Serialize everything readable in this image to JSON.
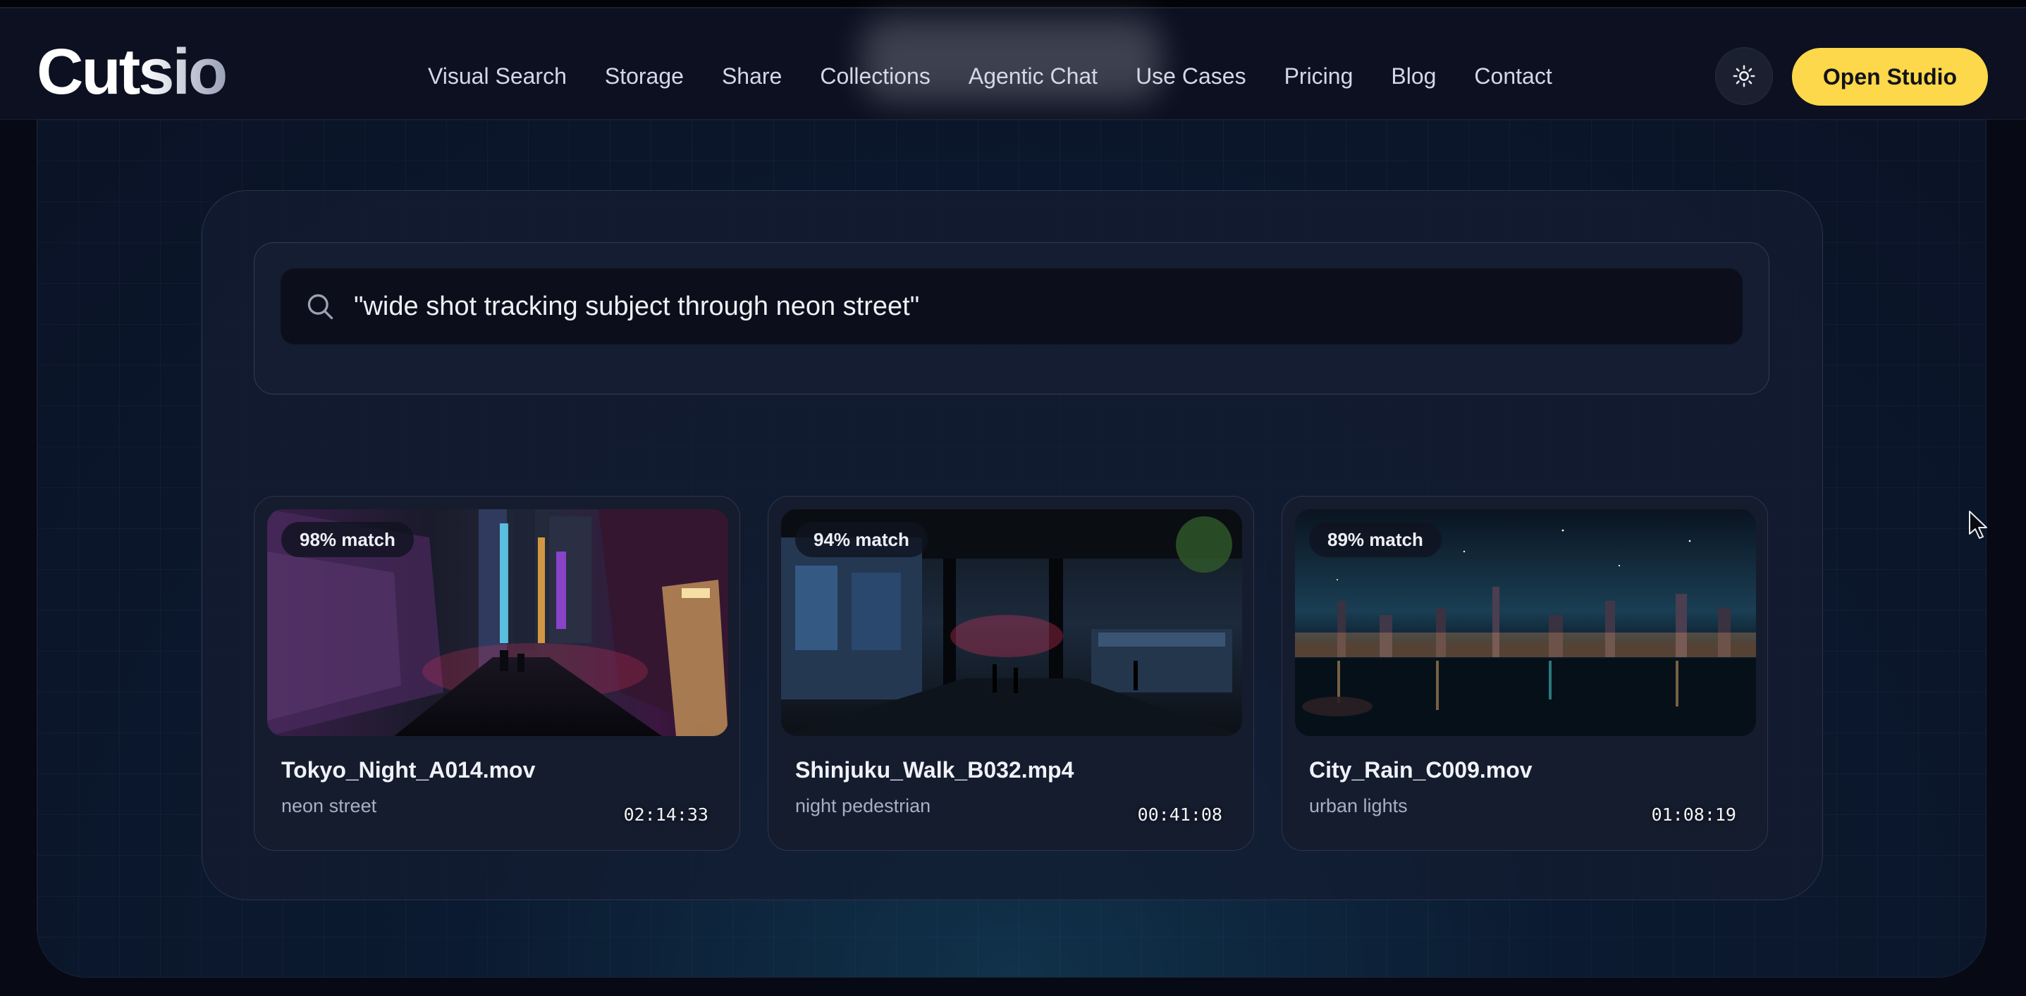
{
  "header": {
    "logo": "Cutsio",
    "nav": [
      {
        "label": "Visual Search"
      },
      {
        "label": "Storage"
      },
      {
        "label": "Share"
      },
      {
        "label": "Collections"
      },
      {
        "label": "Agentic Chat"
      },
      {
        "label": "Use Cases"
      },
      {
        "label": "Pricing"
      },
      {
        "label": "Blog"
      },
      {
        "label": "Contact"
      }
    ],
    "theme_toggle_icon": "sun-icon",
    "cta_label": "Open Studio",
    "cta_color": "#fcd84a"
  },
  "search": {
    "icon": "search-icon",
    "query": "\"wide shot tracking subject through neon street\""
  },
  "results": [
    {
      "match": "98% match",
      "duration": "02:14:33",
      "filename": "Tokyo_Night_A014.mov",
      "tag": "neon street"
    },
    {
      "match": "94% match",
      "duration": "00:41:08",
      "filename": "Shinjuku_Walk_B032.mp4",
      "tag": "night pedestrian"
    },
    {
      "match": "89% match",
      "duration": "01:08:19",
      "filename": "City_Rain_C009.mov",
      "tag": "urban lights"
    }
  ]
}
